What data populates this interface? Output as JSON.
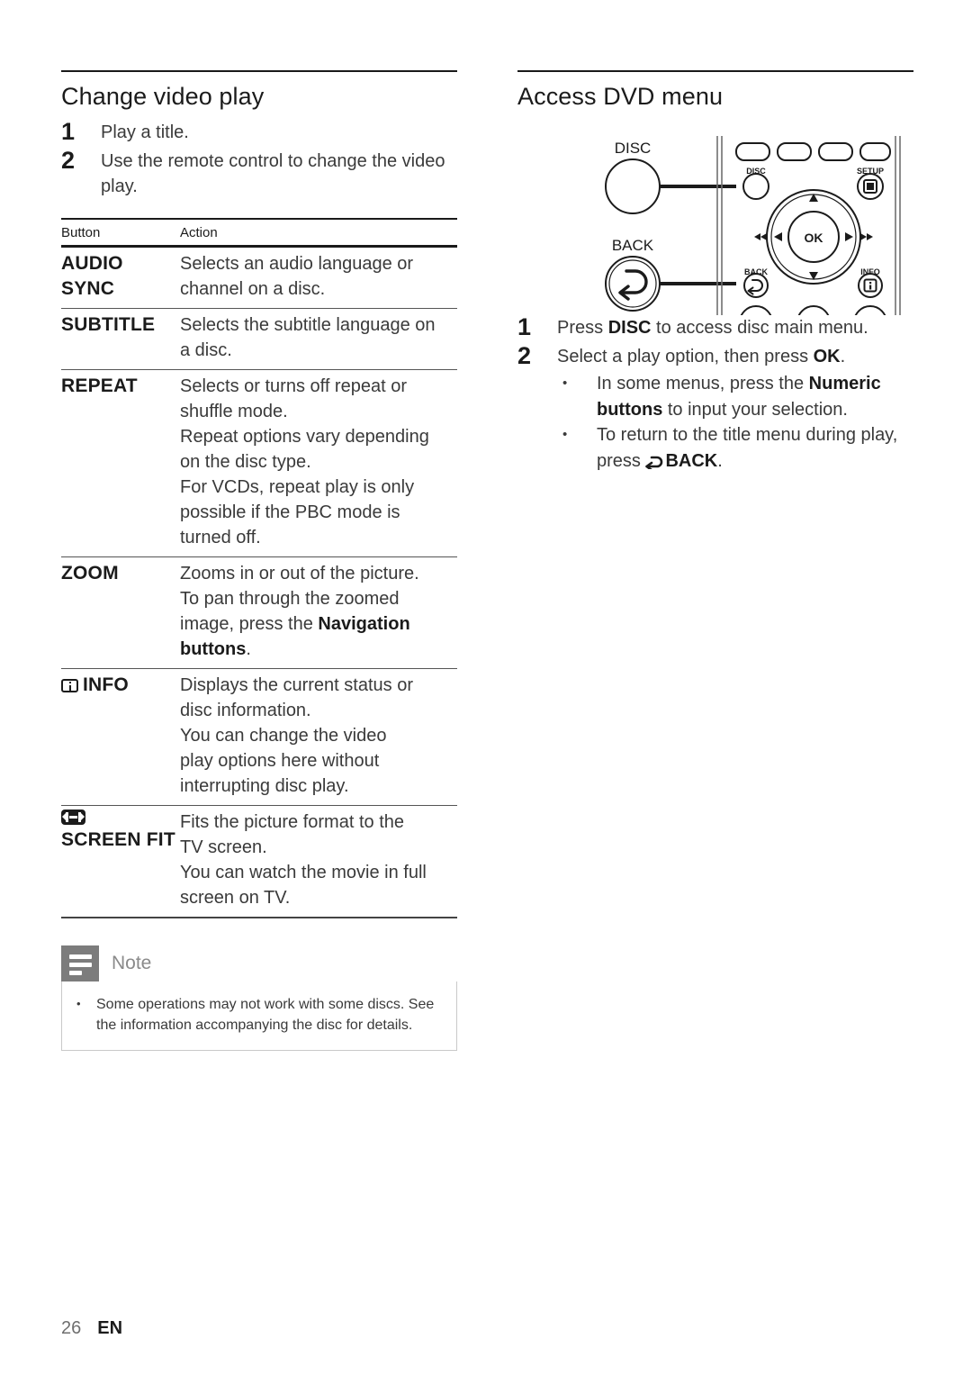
{
  "page": {
    "footer_page_number": "26",
    "footer_language": "EN"
  },
  "left_column": {
    "heading": "Change video play",
    "steps": [
      {
        "num": "1",
        "text": "Play a title."
      },
      {
        "num": "2",
        "text": "Use the remote control to change the video play."
      }
    ],
    "table": {
      "headers": {
        "button": "Button",
        "action": "Action"
      },
      "rows": [
        {
          "button_lines": [
            "AUDIO",
            "SYNC"
          ],
          "action_lines": [
            "Selects an audio language or",
            "channel on a disc."
          ],
          "icon": ""
        },
        {
          "button_lines": [
            "SUBTITLE"
          ],
          "action_lines": [
            "Selects the subtitle language on",
            "a disc."
          ],
          "icon": ""
        },
        {
          "button_lines": [
            "REPEAT"
          ],
          "action_lines": [
            "Selects or turns off repeat or",
            "shuffle mode.",
            "Repeat options vary depending",
            "on the disc type.",
            "For VCDs, repeat play is only",
            "possible if the PBC mode is",
            "turned off."
          ],
          "icon": ""
        },
        {
          "button_lines": [
            "ZOOM"
          ],
          "action_lines": [
            "Zooms in or out of the picture.",
            "To pan through the zoomed",
            "image, press the Navigation",
            "buttons."
          ],
          "action_bold": [
            "Navigation",
            "buttons"
          ],
          "icon": ""
        },
        {
          "button_lines": [
            "INFO"
          ],
          "action_lines": [
            "Displays the current status or",
            "disc information.",
            "You can change the video",
            "play options here without",
            "interrupting disc play."
          ],
          "icon": "info-icon"
        },
        {
          "button_lines": [
            "SCREEN",
            "FIT"
          ],
          "action_lines": [
            "Fits the picture format to the",
            "TV screen.",
            "You can watch the movie in full",
            "screen on TV."
          ],
          "icon": "screen-fit-icon"
        }
      ]
    },
    "note": {
      "title": "Note",
      "items": [
        "Some operations may not work with some discs. See the information accompanying the disc for details."
      ]
    }
  },
  "right_column": {
    "heading": "Access DVD menu",
    "remote_diagram": {
      "callout_disc_label": "DISC",
      "callout_back_label": "BACK",
      "keys": {
        "disc": "DISC",
        "setup": "SETUP",
        "ok": "OK",
        "back": "BACK",
        "info": "INFO"
      }
    },
    "steps": [
      {
        "num": "1",
        "text_parts": [
          {
            "t": "Press ",
            "b": false
          },
          {
            "t": "DISC",
            "b": true
          },
          {
            "t": " to access disc main menu.",
            "b": false
          }
        ]
      },
      {
        "num": "2",
        "text_parts": [
          {
            "t": "Select a play option, then press ",
            "b": false
          },
          {
            "t": "OK",
            "b": true
          },
          {
            "t": ".",
            "b": false
          }
        ],
        "sub_items": [
          {
            "bullet": "•",
            "parts": [
              {
                "t": "In some menus, press the ",
                "b": false
              },
              {
                "t": "Numeric buttons",
                "b": true
              },
              {
                "t": " to input your selection.",
                "b": false
              }
            ]
          },
          {
            "bullet": "•",
            "parts": [
              {
                "t": "To return to the title menu during play, press ",
                "b": false
              },
              {
                "t": "BACK",
                "b": true
              },
              {
                "t": ".",
                "b": false
              }
            ],
            "has_back_glyph": true
          }
        ]
      }
    ]
  },
  "colors": {
    "rule": "#1a1a1a",
    "body_text": "#3a3a3a",
    "heading_text": "#1b1b1b",
    "note_icon_bg": "#7c7c7c",
    "note_title": "#8a8a8a",
    "note_border": "#c9c9c9"
  }
}
